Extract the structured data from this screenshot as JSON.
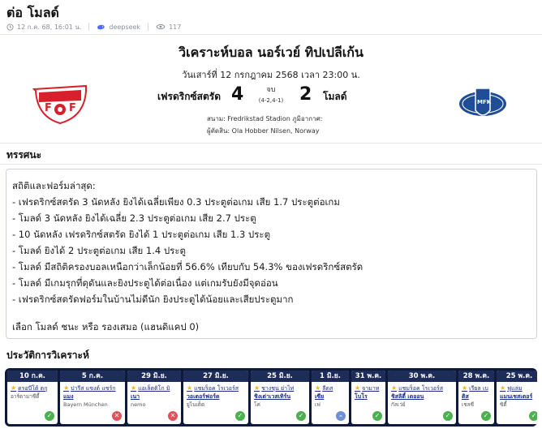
{
  "page": {
    "title": "ต่อ โมลด์",
    "date": "12 ก.ค. 68, 16:01 น.",
    "author": "deepseek",
    "views": "117"
  },
  "match": {
    "title": "วิเคราะห์บอล นอร์เวย์ ทิปเปลีเก้น",
    "datetime": "วันเสาร์ที่ 12 กรกฎาคม 2568 เวลา 23:00 น.",
    "home_team": "เฟรดริกซ์สตรัด",
    "home_score": "4",
    "away_team": "โมลด์",
    "away_score": "2",
    "status": "จบ",
    "halftime": "(4-2,4-1)",
    "venue": "สนาม: Fredrikstad Stadion ภูมิอากาศ:",
    "referee": "ผู้ตัดสิน: Ola Hobber Nilsen, Norway",
    "home_logo_letters": "FFK",
    "away_logo_letters": "MFK",
    "home_color": "#d8202c",
    "away_color": "#1f4e96"
  },
  "analysis": {
    "heading": "ทรรศนะ",
    "lines": [
      "สถิติและฟอร์มล่าสุด:",
      "- เฟรดริกซ์สตรัด 3 นัดหลัง ยิงได้เฉลี่ยเพียง 0.3 ประตูต่อเกม เสีย 1.7 ประตูต่อเกม",
      "- โมลด์ 3 นัดหลัง ยิงได้เฉลี่ย 2.3 ประตูต่อเกม เสีย 2.7 ประตู",
      "- 10 นัดหลัง เฟรดริกซ์สตรัด ยิงได้ 1 ประตูต่อเกม เสีย 1.3 ประตู",
      "- โมลด์ ยิงได้ 2 ประตูต่อเกม เสีย 1.4 ประตู",
      "- โมลด์ มีสถิติครองบอลเหนือกว่าเล็กน้อยที่ 56.6% เทียบกับ 54.3% ของเฟรดริกซ์สตรัด",
      "- โมลด์ มีเกมรุกที่ดุดันและยิงประตูได้ต่อเนื่อง แต่เกมรับยังมีจุดอ่อน",
      "- เฟรดริกซ์สตรัดฟอร์มในบ้านไม่ดีนัก ยิงประตูได้น้อยและเสียประตูมาก"
    ],
    "conclusion": "เลือก โมลด์ ชนะ หรือ รองเสมอ (แฮนดิแคป 0)"
  },
  "history": {
    "heading": "ประวัติการวิเคราะห์",
    "cards": [
      {
        "date": "10 ก.ค.",
        "line1": "ดรอบีโต้ ตกุ",
        "line2": "",
        "line3": "อาร์ดามาซีดี้",
        "status": "win",
        "status_icon": "✓"
      },
      {
        "date": "5 ก.ค.",
        "line1": "ปารีส แซงต์ แชร์ก",
        "line2": "แมง",
        "line3": "Bayern München",
        "status": "loss",
        "status_icon": "✕"
      },
      {
        "date": "29 มิ.ย.",
        "line1": "แอเล็ตติโก มิ",
        "line2": "เนา",
        "line3": "nemo",
        "status": "loss",
        "status_icon": "✕"
      },
      {
        "date": "27 มิ.ย.",
        "line1": "แชมร็อค โรเวอร์ส",
        "line2": "วอเตอร์ฟอร์ด",
        "line3": "ยูไนเต็ด",
        "status": "win",
        "status_icon": "✓"
      },
      {
        "date": "25 มิ.ย.",
        "line1": "ชางชุน ย่าไท่",
        "line2": "ชิงเต่าเวสเทิร์น",
        "line3": "โค่",
        "status": "win",
        "status_icon": "✓"
      },
      {
        "date": "1 มิ.ย.",
        "line1": "ลีดส",
        "line2": "เซีย",
        "line3": "เฟ",
        "status": "push",
        "status_icon": "–"
      },
      {
        "date": "31 พ.ค.",
        "line1": "จามาท",
        "line2": "โบโร",
        "line3": "",
        "status": "win",
        "status_icon": "✓"
      },
      {
        "date": "30 พ.ค.",
        "line1": "แชมร็อค โรเวอร์ส",
        "line2": "ชิสลิตี้ เดออน",
        "line3": "กัลเว่ย์",
        "status": "win",
        "status_icon": "✓"
      },
      {
        "date": "28 พ.ค.",
        "line1": "เรียล เบ",
        "line2": "ติส",
        "line3": "เชลซี",
        "status": "win",
        "status_icon": "✓"
      },
      {
        "date": "25 พ.ค.",
        "line1": "ฟูแล่ม",
        "line2": "แมนเชสเตอร์",
        "line3": "ซิตี้",
        "status": "win",
        "status_icon": "✓"
      }
    ]
  }
}
